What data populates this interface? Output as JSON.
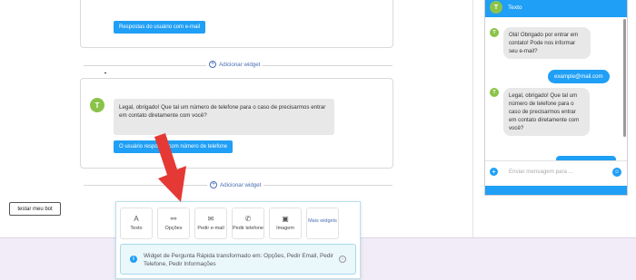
{
  "top_card": {
    "button_label": "Respostas do usuário com e-mail"
  },
  "add_widget_label": "Adicionar widget",
  "mid_card": {
    "avatar_initial": "T",
    "message": "Legal, obrigado! Que tal um número de telefone para o caso de precisarmos entrar em contato diretamente com você?",
    "button_label": "O usuário responde com número de telefone"
  },
  "test_button_label": "testar meu bot",
  "widget_panel": {
    "tiles": [
      {
        "icon": "text-icon",
        "glyph": "A",
        "label": "Texto"
      },
      {
        "icon": "options-icon",
        "glyph": "⚯",
        "label": "Opções"
      },
      {
        "icon": "mail-icon",
        "glyph": "✉",
        "label": "Pedir e-mail"
      },
      {
        "icon": "phone-icon",
        "glyph": "✆",
        "label": "Pedir telefone"
      },
      {
        "icon": "image-icon",
        "glyph": "▣",
        "label": "Imagem"
      },
      {
        "icon": "",
        "glyph": "",
        "label": "Mais widgets"
      }
    ],
    "info_text": "Widget de Pergunta Rápida transformado em: Opções, Pedir Email, Pedir Telefone, Pedir Informações"
  },
  "chat_preview": {
    "header_title": "Texto",
    "avatar_initial": "T",
    "bot_message_1": "Olá! Obrigado por entrar em contato! Pode nos informar seu e-mail?",
    "user_reply": "example@mail.com",
    "bot_message_2": "Legal, obrigado! Que tal um número de telefone para o caso de precisarmos entrar em contato diretamente com você?",
    "input_placeholder": "Enviar mensagem para ..."
  },
  "colors": {
    "accent_blue": "#1f9ff5",
    "avatar_green": "#8bc34a",
    "arrow_red": "#e53935",
    "bottom_band": "#f1ecf7"
  }
}
